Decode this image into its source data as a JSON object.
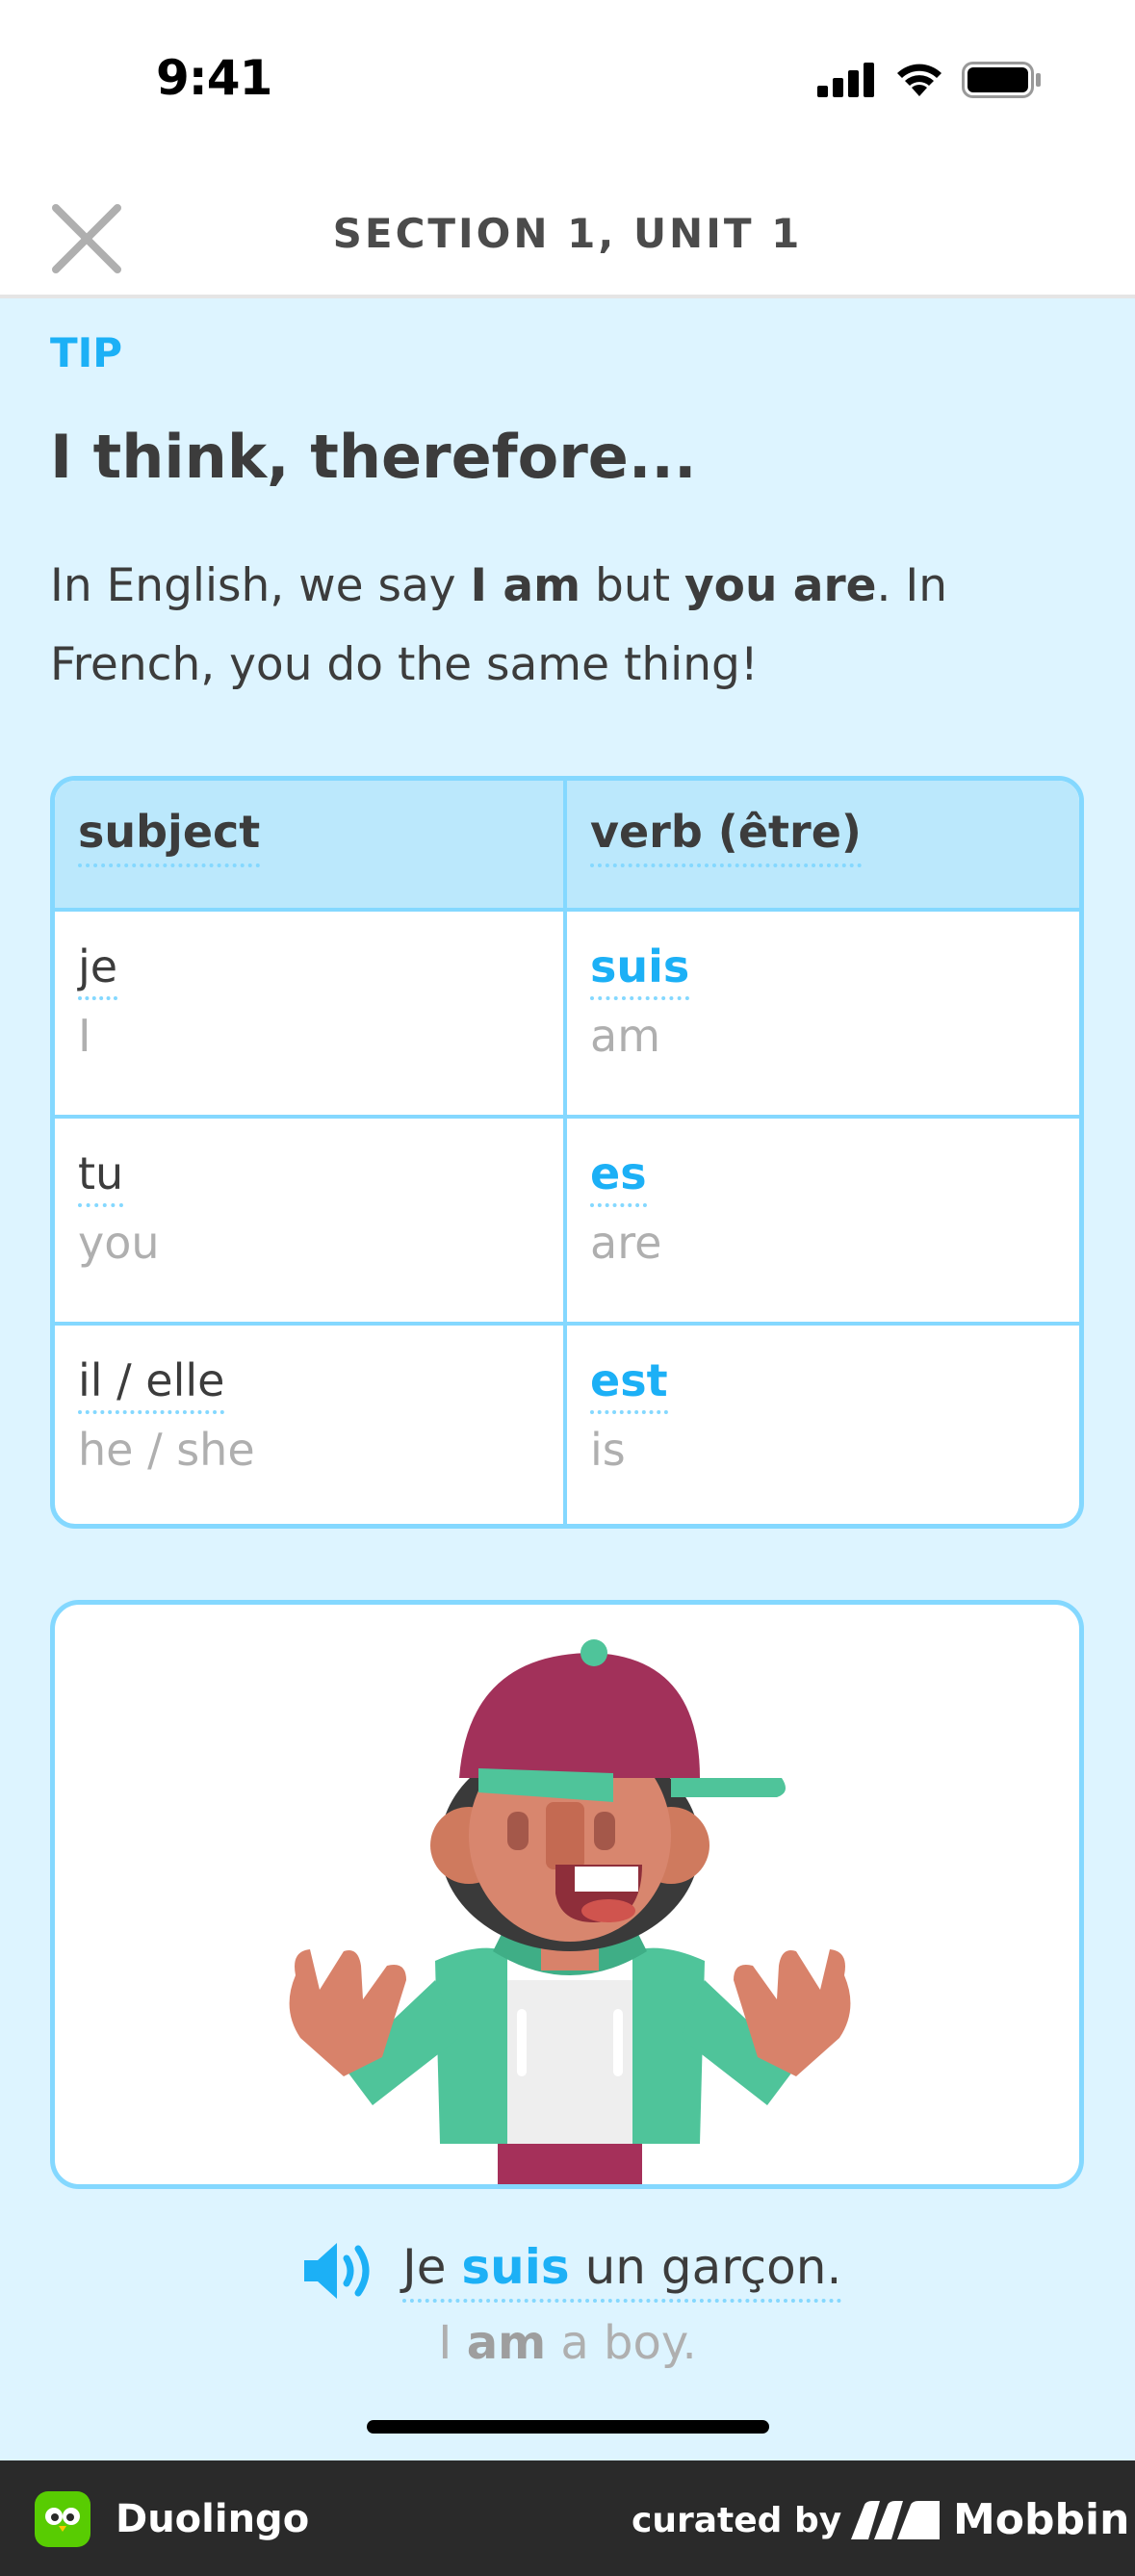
{
  "status": {
    "time": "9:41"
  },
  "header": {
    "title": "SECTION 1, UNIT 1"
  },
  "tip": {
    "label": "TIP",
    "heading": "I think, therefore...",
    "body_part1": "In English, we say ",
    "body_bold1": "I am",
    "body_part2": " but ",
    "body_bold2": "you are",
    "body_part3": ". In French, you do the same thing!"
  },
  "table": {
    "headers": [
      "subject",
      "verb (être)"
    ],
    "rows": [
      {
        "subject": "je",
        "subject_en": "I",
        "verb": "suis",
        "verb_en": "am"
      },
      {
        "subject": "tu",
        "subject_en": "you",
        "verb": "es",
        "verb_en": "are"
      },
      {
        "subject": "il / elle",
        "subject_en": "he / she",
        "verb": "est",
        "verb_en": "is"
      }
    ]
  },
  "example": {
    "fr_before": "Je ",
    "fr_highlight": "suis",
    "fr_after": " un garçon.",
    "en_before": "I ",
    "en_bold": "am",
    "en_after": " a boy."
  },
  "footer": {
    "app_name": "Duolingo",
    "curated_by": "curated by",
    "brand": "Mobbin"
  },
  "colors": {
    "accent": "#1cb0f6",
    "background": "#ddf4ff",
    "border": "#84d8ff",
    "header_cell": "#bbe8fc"
  }
}
